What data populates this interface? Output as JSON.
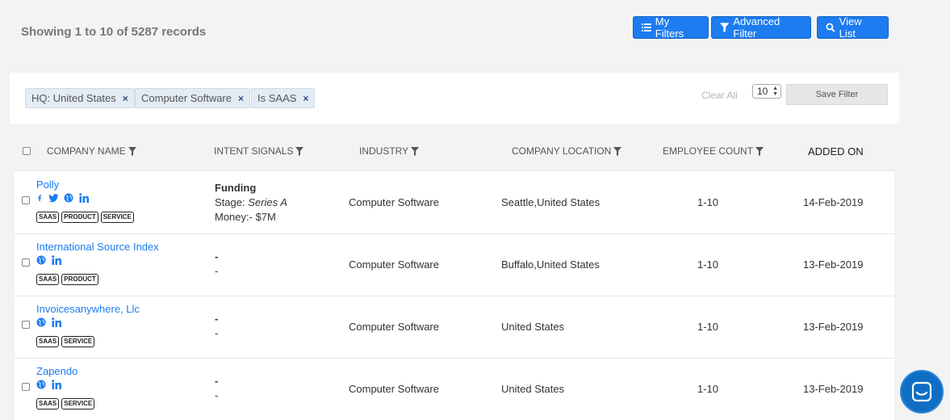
{
  "header": {
    "records_text": "Showing 1 to 10 of 5287 records",
    "buttons": {
      "my_filters": "My Filters",
      "advanced_filter": "Advanced Filter",
      "view_list": "View List"
    }
  },
  "filters": {
    "chips": [
      "HQ: United States",
      "Computer Software",
      "Is SAAS"
    ],
    "remove_symbol": "×",
    "clear_all": "Clear All",
    "page_size": "10",
    "save_filter": "Save Filter"
  },
  "table": {
    "columns": {
      "company_name": "COMPANY NAME",
      "intent_signals": "INTENT SIGNALS",
      "industry": "INDUSTRY",
      "company_location": "COMPANY LOCATION",
      "employee_count": "EMPLOYEE COUNT",
      "added_on": "ADDED ON"
    },
    "rows": [
      {
        "name": "Polly",
        "social": [
          "facebook-icon",
          "twitter-icon",
          "globe-icon",
          "linkedin-icon"
        ],
        "tags": [
          "SAAS",
          "PRODUCT",
          "SERVICE"
        ],
        "intent_title": "Funding",
        "intent_stage_label": "Stage:",
        "intent_stage_value": "Series A",
        "intent_money": "Money:- $7M",
        "industry": "Computer Software",
        "location": "Seattle,United States",
        "employees": "1-10",
        "added": "14-Feb-2019"
      },
      {
        "name": "International Source Index",
        "social": [
          "globe-icon",
          "linkedin-icon"
        ],
        "tags": [
          "SAAS",
          "PRODUCT"
        ],
        "intent_title": "-",
        "intent_line2": "-",
        "industry": "Computer Software",
        "location": "Buffalo,United States",
        "employees": "1-10",
        "added": "13-Feb-2019"
      },
      {
        "name": "Invoicesanywhere, Llc",
        "social": [
          "globe-icon",
          "linkedin-icon"
        ],
        "tags": [
          "SAAS",
          "SERVICE"
        ],
        "intent_title": "-",
        "intent_line2": "-",
        "industry": "Computer Software",
        "location": "United States",
        "employees": "1-10",
        "added": "13-Feb-2019"
      },
      {
        "name": "Zapendo",
        "social": [
          "globe-icon",
          "linkedin-icon"
        ],
        "tags": [
          "SAAS",
          "SERVICE"
        ],
        "intent_title": "-",
        "intent_line2": "-",
        "industry": "Computer Software",
        "location": "United States",
        "employees": "1-10",
        "added": "13-Feb-2019"
      }
    ]
  },
  "colors": {
    "accent": "#1c7cf0",
    "chip_bg": "#e3ecf4",
    "chat_bg": "#0f6ec4"
  }
}
